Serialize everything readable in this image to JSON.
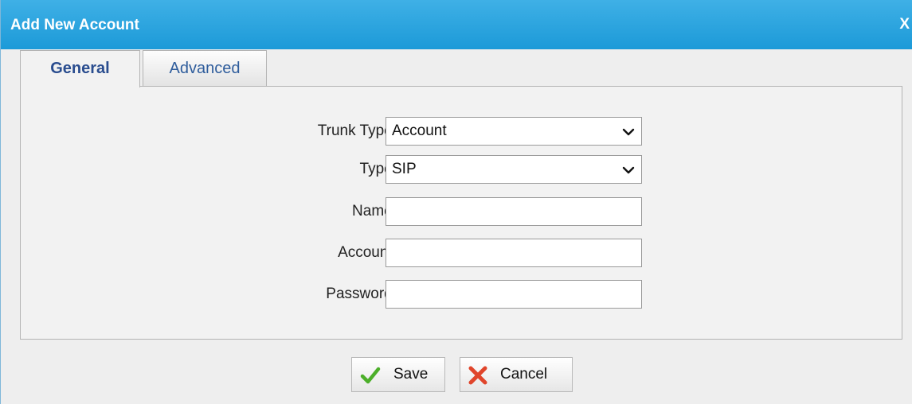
{
  "dialog": {
    "title": "Add New Account",
    "close_label": "X"
  },
  "tabs": [
    {
      "label": "General",
      "active": true
    },
    {
      "label": "Advanced",
      "active": false
    }
  ],
  "form": {
    "trunk_type": {
      "label": "Trunk Type:",
      "value": "Account"
    },
    "type": {
      "label": "Type:",
      "value": "SIP"
    },
    "name": {
      "label": "Name:",
      "value": ""
    },
    "account": {
      "label": "Account:",
      "value": ""
    },
    "password": {
      "label": "Password:",
      "value": ""
    }
  },
  "buttons": {
    "save_label": "Save",
    "cancel_label": "Cancel"
  },
  "colors": {
    "titlebar": "#1c9ad8",
    "tab_text": "#2a4d8f",
    "save_check": "#4caf2a",
    "cancel_x": "#e0452b"
  },
  "icons": {
    "save": "checkmark-icon",
    "cancel": "x-mark-icon",
    "select": "chevron-down-icon"
  }
}
